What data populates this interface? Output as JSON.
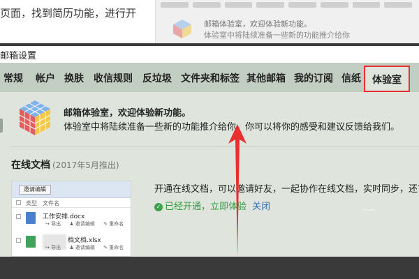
{
  "top_strip": {
    "instruction": "页面，找到简历功能，进行开",
    "bg_title": "邮箱体验室，欢迎体验新功能。",
    "bg_sub": "体验室中将陆续准备一些新的功能推介给你"
  },
  "settings": {
    "title": "邮箱设置"
  },
  "tabs": [
    {
      "label": "常规",
      "active": false
    },
    {
      "label": "帐户",
      "active": false
    },
    {
      "label": "换肤",
      "active": false
    },
    {
      "label": "收信规则",
      "active": false
    },
    {
      "label": "反垃圾",
      "active": false
    },
    {
      "label": "文件夹和标签",
      "active": false
    },
    {
      "label": "其他邮箱",
      "active": false
    },
    {
      "label": "我的订阅",
      "active": false
    },
    {
      "label": "信纸",
      "active": false
    },
    {
      "label": "体验室",
      "active": true
    }
  ],
  "intro": {
    "title": "邮箱体验室，欢迎体验新功能。",
    "description": "体验室中将陆续准备一些新的功能推介给你，你可以将你的感受和建议反馈给我们。"
  },
  "section": {
    "title": "在线文档",
    "date": "(2017年5月推出)"
  },
  "preview": {
    "button": "邀请编辑",
    "col_type": "类型",
    "col_name": "文件名",
    "rows": [
      {
        "name": "工作安排.docx",
        "actions": [
          "导出",
          "邀请编辑",
          "重命名"
        ]
      },
      {
        "name": "档文档.xlsx",
        "actions": [
          "导出",
          "邀请编辑",
          "重命名"
        ]
      }
    ]
  },
  "feature": {
    "description": "开通在线文档，可以邀请好友，一起协作在线文档，实时同步，还可",
    "status": "已经开通，",
    "try_link": "立即体验",
    "close_link": "关闭"
  },
  "colors": {
    "tabbar": "#c3cec3",
    "panel": "#dfe4dd",
    "highlight": "#e8302f",
    "success": "#2f9b3c",
    "link": "#2b6fb3"
  },
  "icons": [
    "cube-icon",
    "check-circle-icon",
    "docx-file-icon",
    "xlsx-file-icon",
    "red-arrow-annotation-icon"
  ]
}
